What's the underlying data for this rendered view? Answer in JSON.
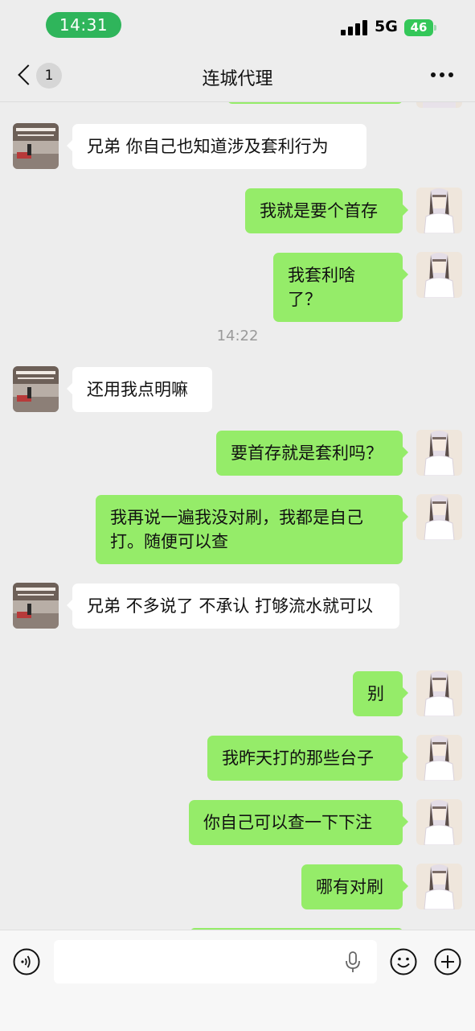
{
  "status_bar": {
    "time": "14:31",
    "network": "5G",
    "battery": "46"
  },
  "nav": {
    "back_count": "1",
    "title": "连城代理"
  },
  "chat": {
    "timestamp": "14:22",
    "messages": [
      {
        "side": "left",
        "text": "兄弟 你自己也知道涉及套利行为"
      },
      {
        "side": "right",
        "text": "我就是要个首存"
      },
      {
        "side": "right",
        "text": "我套利啥了？"
      },
      {
        "side": "left",
        "text": "还用我点明嘛"
      },
      {
        "side": "right",
        "text": "要首存就是套利吗？"
      },
      {
        "side": "right",
        "text": "我再说一遍我没对刷，我都是自己打。随便可以查"
      },
      {
        "side": "left",
        "text": "兄弟 不多说了 不承认 打够流水就可以"
      },
      {
        "side": "right",
        "text": "别"
      },
      {
        "side": "right",
        "text": "我昨天打的那些台子"
      },
      {
        "side": "right",
        "text": "你自己可以查一下下注"
      },
      {
        "side": "right",
        "text": "哪有对刷"
      }
    ]
  },
  "colors": {
    "self_bubble": "#95ec69",
    "other_bubble": "#ffffff",
    "background": "#ededed",
    "status_time": "#2fb55b"
  },
  "icons": [
    "back-chevron-icon",
    "more-dots-icon",
    "voice-icon",
    "mic-icon",
    "emoji-icon",
    "plus-icon"
  ]
}
